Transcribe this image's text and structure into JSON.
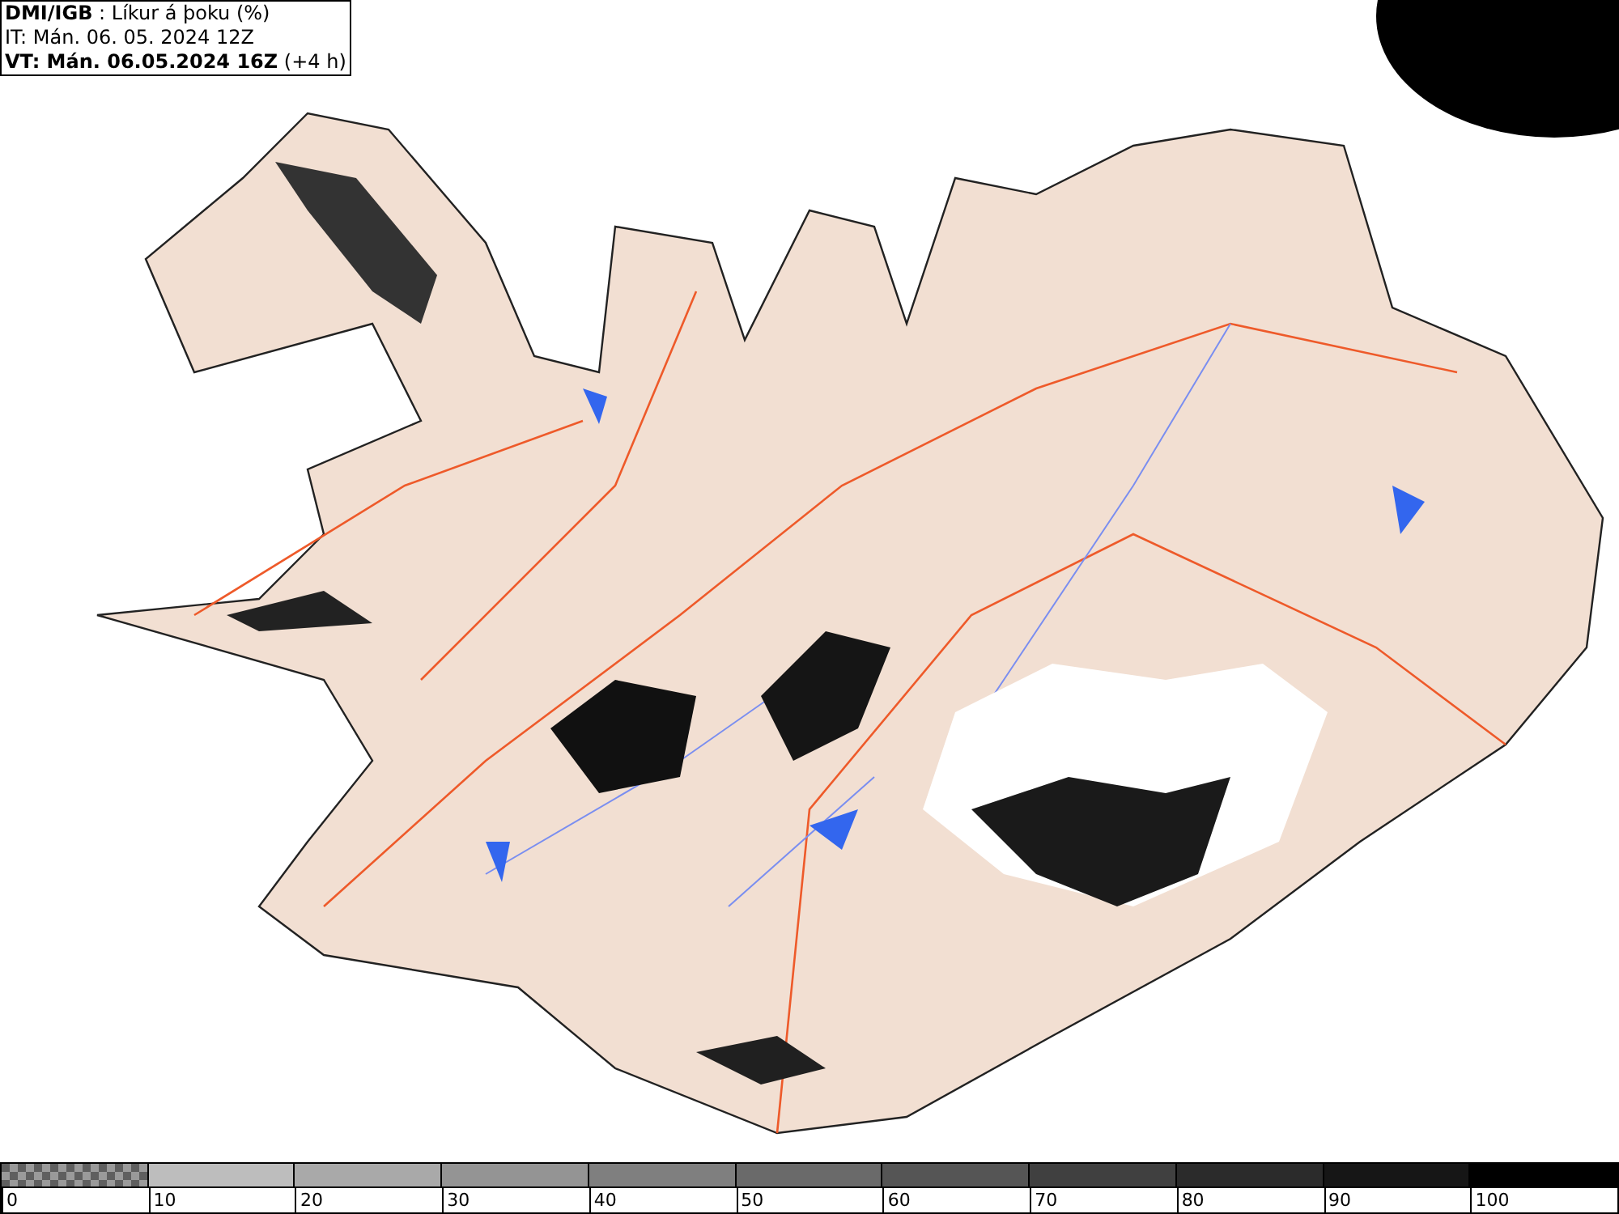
{
  "header": {
    "lines": [
      "**DMI/IGB** : Líkur á þoku (%)",
      "IT: Mán. 06. 05. 2024 12Z",
      "**VT: Mán. 06.05.2024 16Z** (+4 h)"
    ]
  },
  "legend": {
    "bins": [
      {
        "label": "0",
        "kind": "checker"
      },
      {
        "label": "10",
        "kind": "solid",
        "color": "#bdbdbd"
      },
      {
        "label": "20",
        "kind": "solid",
        "color": "#a9a9a9"
      },
      {
        "label": "30",
        "kind": "solid",
        "color": "#949494"
      },
      {
        "label": "40",
        "kind": "solid",
        "color": "#7f7f7f"
      },
      {
        "label": "50",
        "kind": "solid",
        "color": "#6a6a6a"
      },
      {
        "label": "60",
        "kind": "solid",
        "color": "#555555"
      },
      {
        "label": "70",
        "kind": "solid",
        "color": "#404040"
      },
      {
        "label": "80",
        "kind": "solid",
        "color": "#2b2b2b"
      },
      {
        "label": "90",
        "kind": "solid",
        "color": "#161616"
      },
      {
        "label": "100",
        "kind": "solid",
        "color": "#000000"
      }
    ]
  }
}
